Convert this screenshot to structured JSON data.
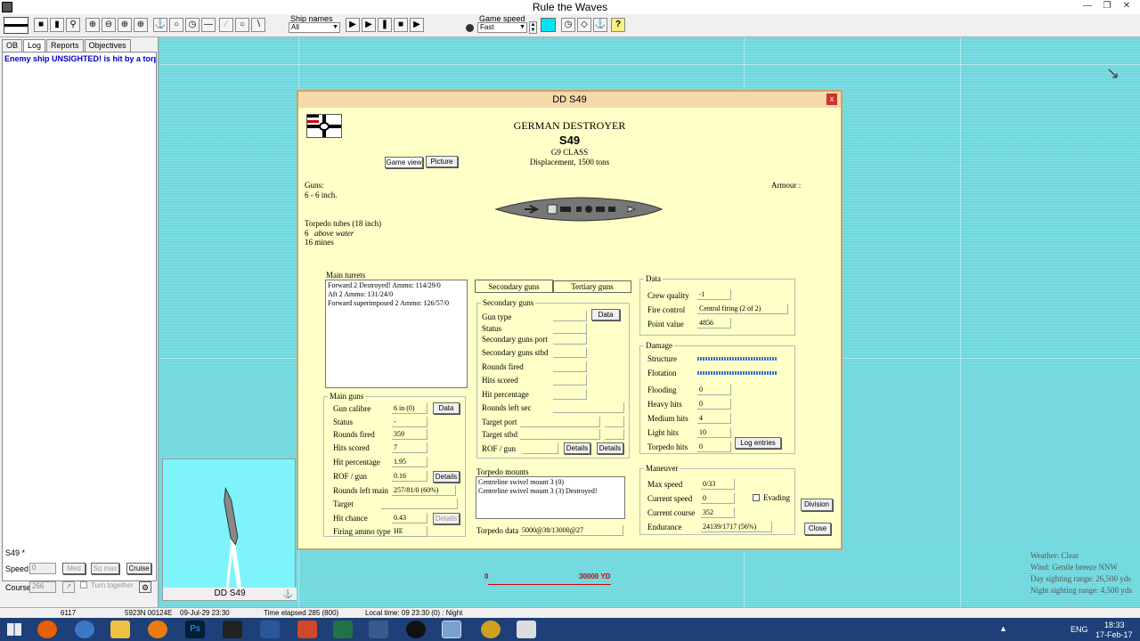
{
  "window": {
    "title": "Rule the Waves"
  },
  "toolbar": {
    "ship_names_label": "Ship names",
    "ship_names_value": "All",
    "game_speed_label": "Game speed",
    "game_speed_value": "Fast",
    "help_glyph": "?"
  },
  "left": {
    "tabs": [
      "OB",
      "Log",
      "Reports",
      "Objectives"
    ],
    "log_lines": [
      "Enemy ship UNSIGHTED! is hit by a torped"
    ],
    "ship": "S49 *",
    "speed_label": "Speed",
    "speed_value": "0",
    "med": "Med",
    "sqmax": "Sq max",
    "cruise": "Cruise",
    "course_label": "Course",
    "course_value": "266",
    "turn_together": "Turn together"
  },
  "minimap": {
    "caption": "DD S49"
  },
  "dialog": {
    "title": "DD S49",
    "close_x": "x",
    "nation": "GERMAN DESTROYER",
    "name": "S49",
    "class": "G9 CLASS",
    "displacement": "Displacement, 1500 tons",
    "tab_game": "Game view",
    "tab_picture": "Picture",
    "guns_label": "Guns:",
    "guns_value": "6 - 6 inch.",
    "armour_label": "Armour :",
    "torp_label": "Torpedo tubes (18 inch)",
    "torp_count": "6",
    "torp_pos": "above water",
    "mines": "16 mines",
    "main_turrets_title": "Main turrets",
    "main_turrets": [
      "Forward 2 Destroyed! Ammo: 114/29/0",
      "Aft 2 Ammo: 131/24/0",
      "Forward superimposed 2 Ammo: 126/57/0"
    ],
    "main_guns_title": "Main guns",
    "main_guns": {
      "calibre_l": "Gun calibre",
      "calibre": "6 in (0)",
      "status_l": "Status",
      "status": "-",
      "fired_l": "Rounds fired",
      "fired": "359",
      "hits_l": "Hits scored",
      "hits": "7",
      "pct_l": "Hit percentage",
      "pct": "1.95",
      "rof_l": "ROF / gun",
      "rof": "0.16",
      "left_l": "Rounds left main",
      "left": "257/81/0 (60%)",
      "target_l": "Target",
      "target": "",
      "chance_l": "Hit chance",
      "chance": "0.43",
      "ammo_l": "Firing ammo type",
      "ammo": "HE"
    },
    "data_btn": "Data",
    "details_btn": "Details",
    "sec_tab": "Secondary guns",
    "ter_tab": "Tertiary guns",
    "sec_title": "Secondary guns",
    "sec_labels": [
      "Gun type",
      "Status",
      "Secondary guns port",
      "Secondary guns stbd",
      "Rounds fired",
      "Hits scored",
      "Hit percentage",
      "Rounds left sec",
      "Target port",
      "Target stbd",
      "ROF / gun"
    ],
    "torp_mounts_title": "Torpedo mounts",
    "torp_mounts": [
      "Centreline swivel mount 3 (0)",
      "Centreline swivel mount 3 (3) Destroyed!"
    ],
    "torp_data_l": "Torpedo data",
    "torp_data": "5000@38/13000@27",
    "data_title": "Data",
    "crew_l": "Crew quality",
    "crew": "-1",
    "fc_l": "Fire control",
    "fc": "Central firing (2 of 2)",
    "pv_l": "Point value",
    "pv": "4856",
    "damage_title": "Damage",
    "structure_l": "Structure",
    "structure_pct": 100,
    "flotation_l": "Flotation",
    "flotation_pct": 100,
    "flooding_l": "Flooding",
    "flooding": "0",
    "heavy_l": "Heavy hits",
    "heavy": "0",
    "medium_l": "Medium hits",
    "medium": "4",
    "light_l": "Light hits",
    "light": "10",
    "torphits_l": "Torpedo hits",
    "torphits": "0",
    "log_btn": "Log entries",
    "man_title": "Maneuver",
    "maxspd_l": "Max speed",
    "maxspd": "0/33",
    "curspd_l": "Current speed",
    "curspd": "0",
    "evading": "Evading",
    "course_l": "Current course",
    "course": "352",
    "endur_l": "Endurance",
    "endur": "24139/1717 (56%)",
    "division_btn": "Division",
    "close_btn": "Close"
  },
  "scale": {
    "start": "0",
    "end": "30000 YD"
  },
  "weather": {
    "w": "Weather: Clear",
    "wind": "Wind: Gentle breeze  NNW",
    "day": "Day sighting range: 26,500 yds",
    "night": "Night sighting range: 4,500 yds"
  },
  "status": {
    "a": "6117",
    "b": "5923N 00124E",
    "c": "09-Jul-29 23:30",
    "d": "Time elapsed 285 (800)",
    "e": "Local time: 09 23:30 (0) : Night"
  },
  "tray": {
    "lang": "ENG",
    "time": "18:33",
    "date": "17-Feb-17"
  }
}
